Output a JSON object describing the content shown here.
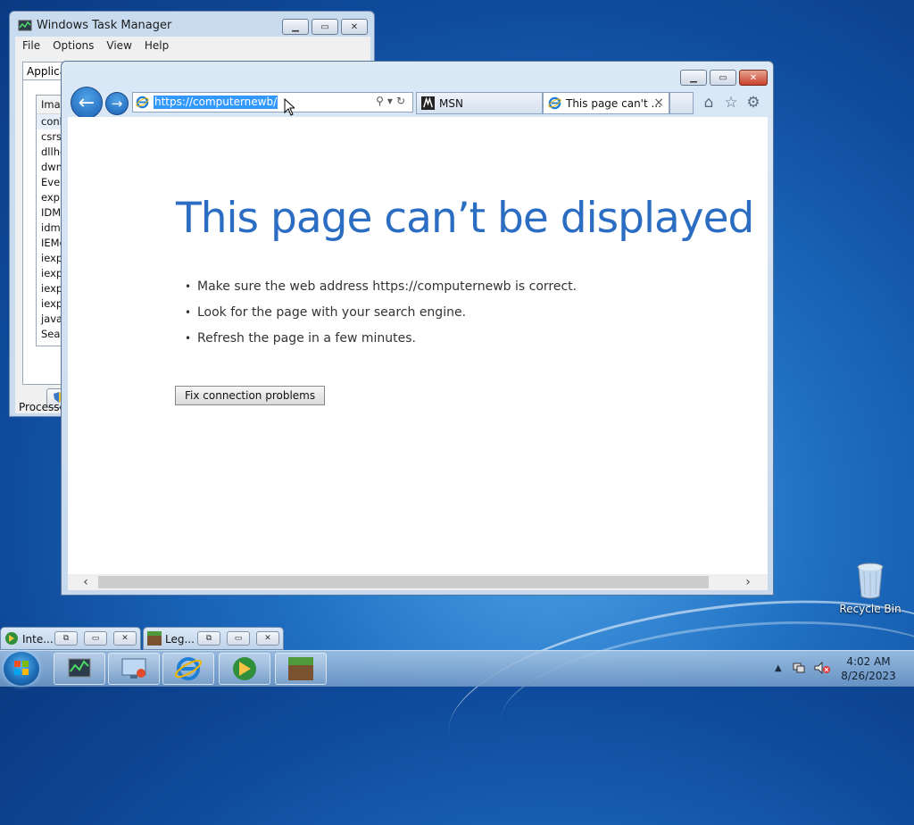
{
  "task_manager": {
    "title": "Windows Task Manager",
    "menu": [
      "File",
      "Options",
      "View",
      "Help"
    ],
    "tab_label": "Applicati",
    "list_header": "Imag",
    "processes": [
      "conh",
      "csrs",
      "dllho",
      "dwm",
      "Ever",
      "expl",
      "IDM",
      "idmB",
      "IEMo",
      "iexp",
      "iexp",
      "iexp",
      "iexp",
      "java",
      "Sear"
    ],
    "status_label": "Processes"
  },
  "ie": {
    "address_url": "https://computernewb/",
    "tabs": [
      {
        "label": "MSN",
        "icon": "msn-icon",
        "active": false
      },
      {
        "label": "This page can't ...",
        "icon": "ie-icon",
        "active": true
      }
    ],
    "toolbar_icons": [
      "home-icon",
      "star-icon",
      "gear-icon"
    ],
    "page": {
      "heading": "This page can’t be displayed",
      "bullets": [
        "Make sure the web address https://computernewb is correct.",
        "Look for the page with your search engine.",
        "Refresh the page in a few minutes."
      ],
      "fix_button": "Fix connection problems"
    }
  },
  "desktop": {
    "recycle_bin_label": "Recycle Bin"
  },
  "minimized_windows": [
    {
      "label": "Inte...",
      "icon": "idm-icon"
    },
    {
      "label": "Leg...",
      "icon": "minecraft-icon"
    }
  ],
  "taskbar": {
    "pinned": [
      "task-manager",
      "remote-desktop",
      "internet-explorer",
      "internet-download-manager",
      "minecraft"
    ],
    "time": "4:02 AM",
    "date": "8/26/2023"
  }
}
